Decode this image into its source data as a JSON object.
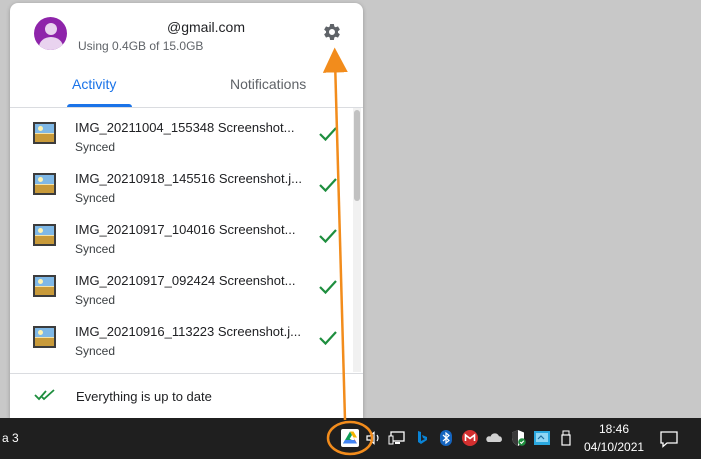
{
  "account": {
    "email": "@gmail.com",
    "storage": "Using 0.4GB of 15.0GB",
    "avatar_icon": "person-icon",
    "settings_icon": "gear-icon"
  },
  "tabs": [
    {
      "label": "Activity",
      "active": true
    },
    {
      "label": "Notifications",
      "active": false
    }
  ],
  "files": [
    {
      "name": "IMG_20211004_155348 Screenshot...",
      "status": "Synced"
    },
    {
      "name": "IMG_20210918_145516 Screenshot.j...",
      "status": "Synced"
    },
    {
      "name": "IMG_20210917_104016 Screenshot...",
      "status": "Synced"
    },
    {
      "name": "IMG_20210917_092424 Screenshot...",
      "status": "Synced"
    },
    {
      "name": "IMG_20210916_113223 Screenshot.j...",
      "status": "Synced"
    }
  ],
  "footer": {
    "status": "Everything is up to date",
    "icon": "double-check-icon"
  },
  "taskbar": {
    "label": "a 3",
    "time": "18:46",
    "date": "04/10/2021"
  },
  "colors": {
    "accent": "#1a73e8",
    "synced_check": "#1e8e3e",
    "annotation": "#f28c1c"
  }
}
